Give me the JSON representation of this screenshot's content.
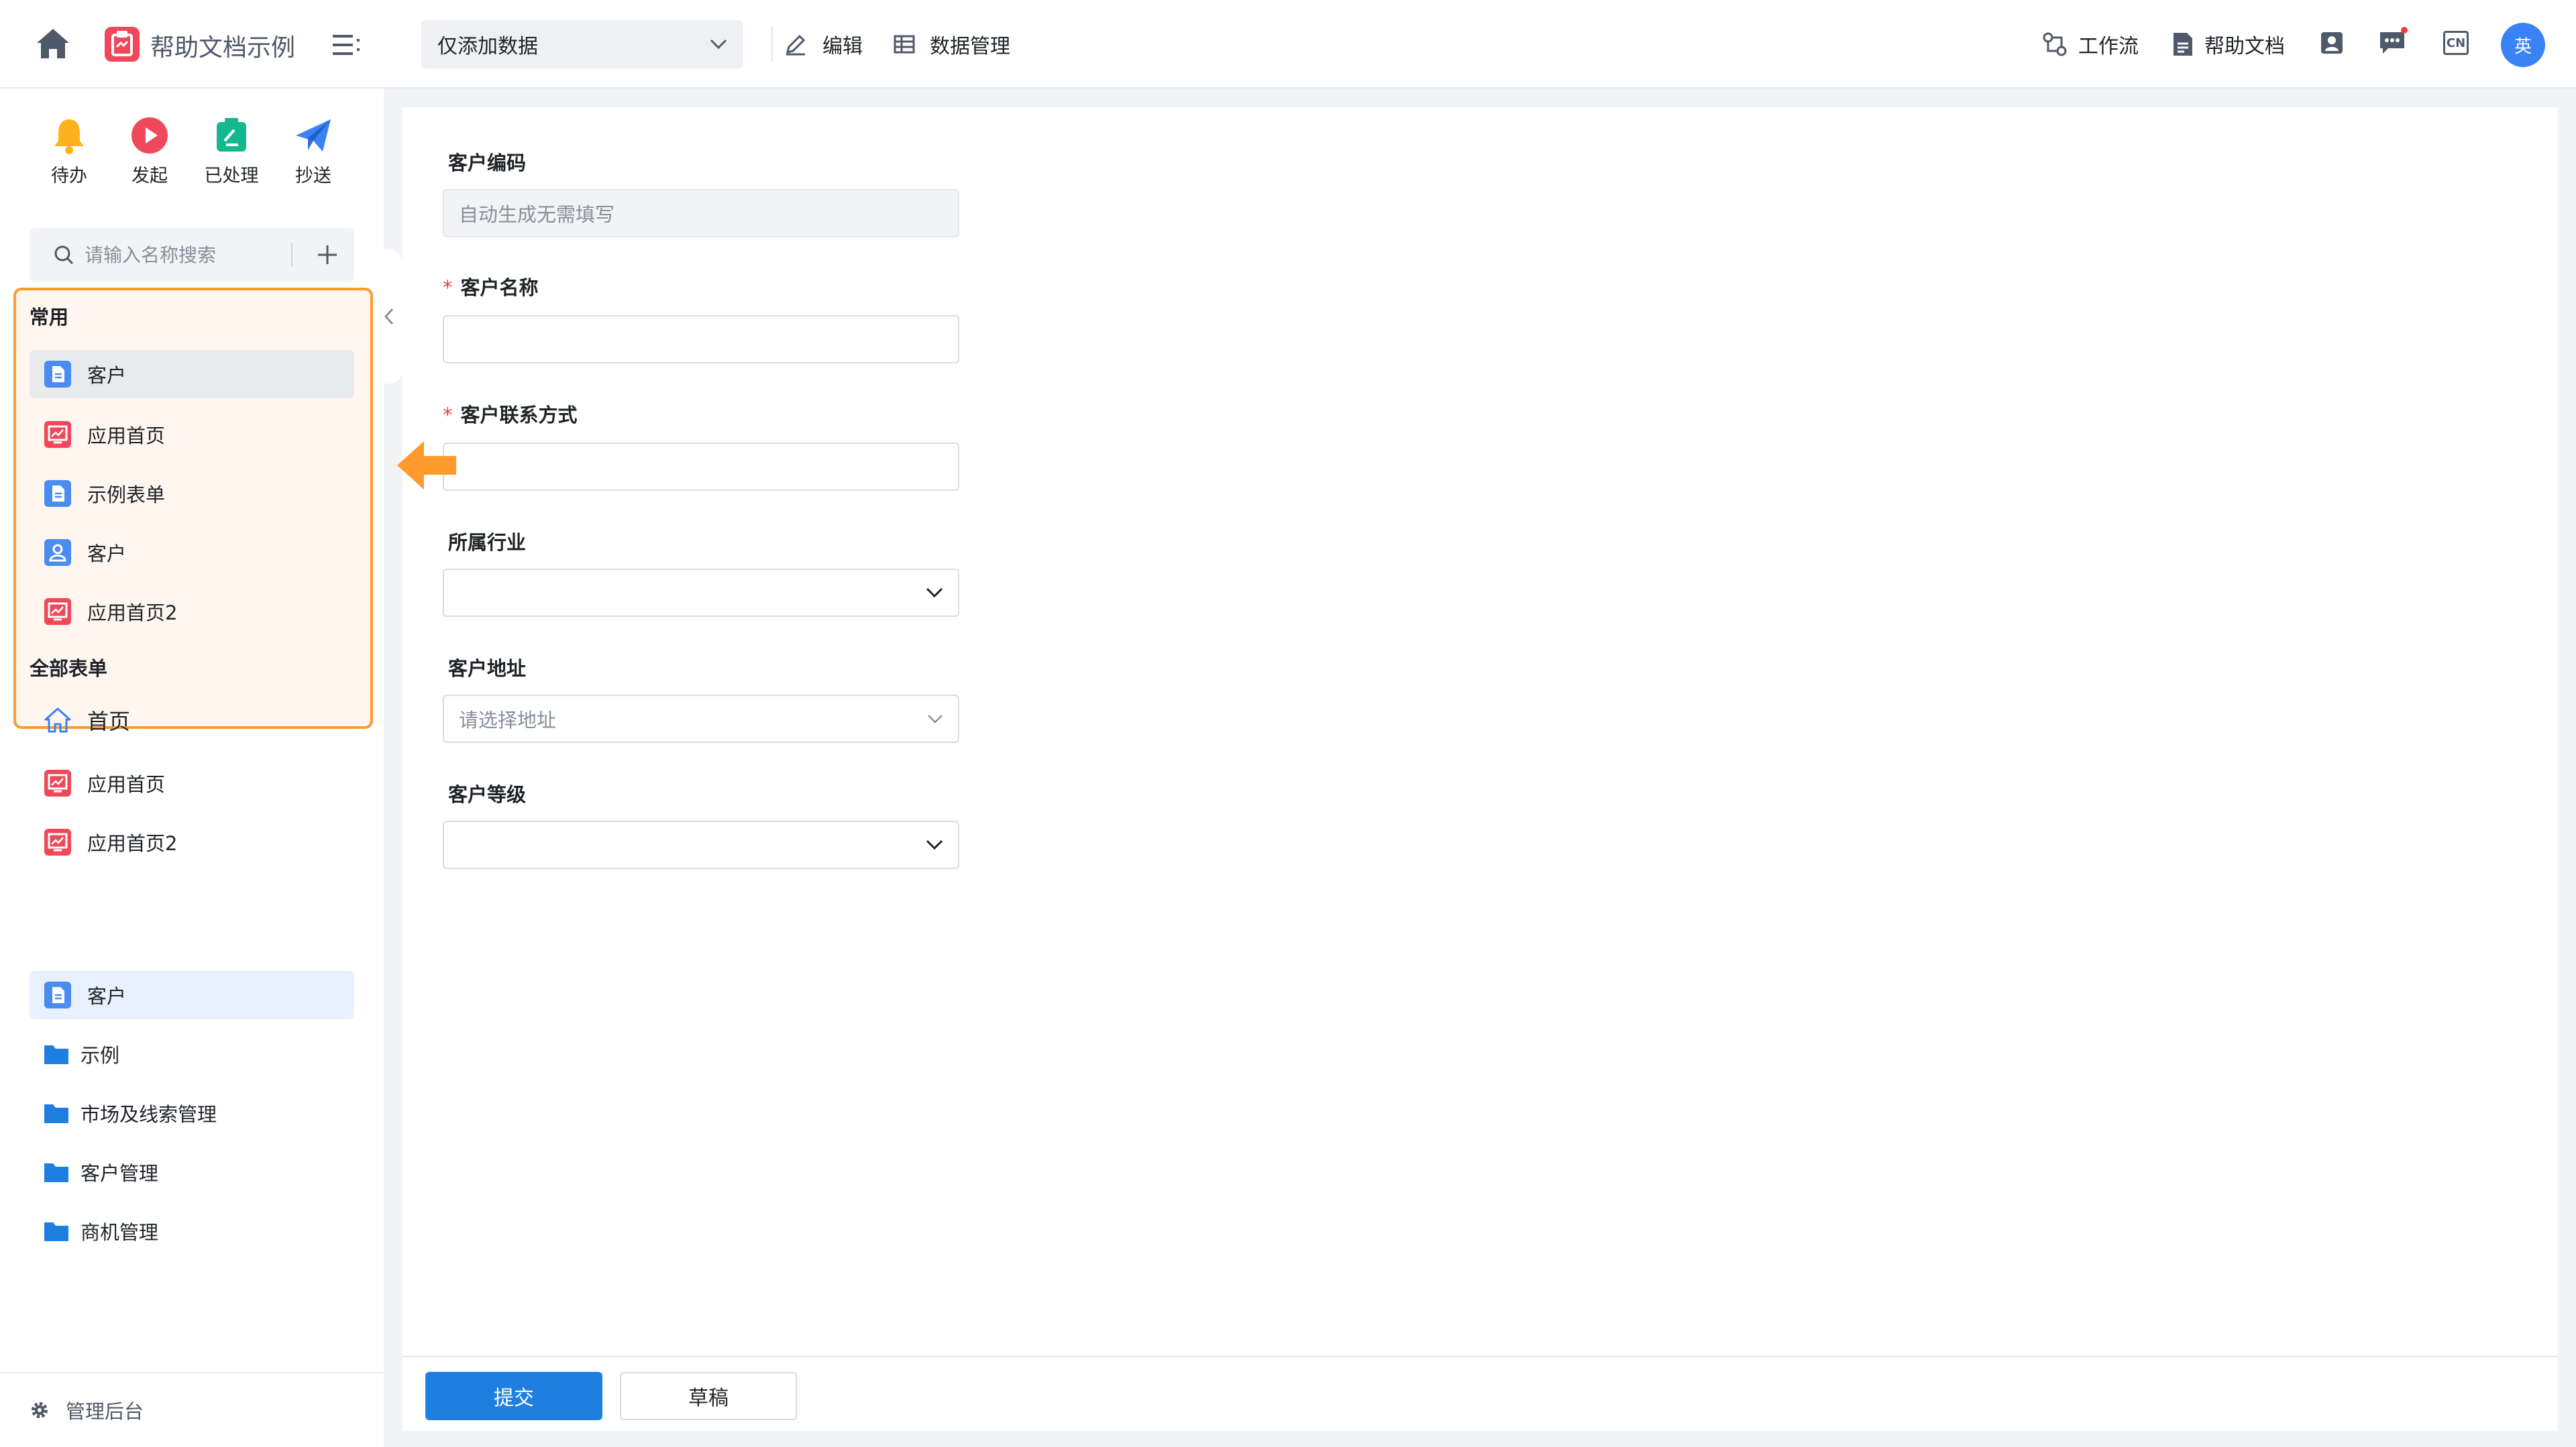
{
  "topbar": {
    "app_title": "帮助文档示例",
    "form_select_value": "仅添加数据",
    "edit_label": "编辑",
    "data_mgmt_label": "数据管理",
    "workflow_label": "工作流",
    "help_doc_label": "帮助文档",
    "lang_badge": "CN",
    "avatar_text": "英",
    "accent_color": "#3b82f6"
  },
  "sidebar": {
    "quick_actions": [
      {
        "label": "待办",
        "icon": "bell-icon"
      },
      {
        "label": "发起",
        "icon": "play-icon"
      },
      {
        "label": "已处理",
        "icon": "done-icon"
      },
      {
        "label": "抄送",
        "icon": "send-icon"
      }
    ],
    "search_placeholder": "请输入名称搜索",
    "favorites_title": "常用",
    "favorites": [
      {
        "label": "客户",
        "icon": "form-doc-icon",
        "selected": true
      },
      {
        "label": "应用首页",
        "icon": "dashboard-icon"
      },
      {
        "label": "示例表单",
        "icon": "form-doc-icon"
      },
      {
        "label": "客户",
        "icon": "user-form-icon"
      },
      {
        "label": "应用首页2",
        "icon": "dashboard-icon"
      }
    ],
    "all_forms_title": "全部表单",
    "all_forms": [
      {
        "label": "首页",
        "icon": "home-outline-icon"
      },
      {
        "label": "应用首页",
        "icon": "dashboard-icon"
      },
      {
        "label": "应用首页2",
        "icon": "dashboard-icon"
      },
      {
        "label": "客户",
        "icon": "form-doc-icon",
        "selected": true
      },
      {
        "label": "示例",
        "icon": "folder-icon"
      },
      {
        "label": "市场及线索管理",
        "icon": "folder-icon"
      },
      {
        "label": "客户管理",
        "icon": "folder-icon"
      },
      {
        "label": "商机管理",
        "icon": "folder-icon"
      }
    ],
    "admin_label": "管理后台",
    "highlight_color": "#ff9a2e"
  },
  "form": {
    "fields": [
      {
        "label": "客户编码",
        "required": false,
        "type": "text",
        "value": "自动生成无需填写",
        "disabled": true
      },
      {
        "label": "客户名称",
        "required": true,
        "type": "text",
        "value": ""
      },
      {
        "label": "客户联系方式",
        "required": true,
        "type": "text",
        "value": ""
      },
      {
        "label": "所属行业",
        "required": false,
        "type": "select",
        "value": ""
      },
      {
        "label": "客户地址",
        "required": false,
        "type": "address",
        "placeholder": "请选择地址"
      },
      {
        "label": "客户等级",
        "required": false,
        "type": "select",
        "value": ""
      }
    ],
    "submit_label": "提交",
    "draft_label": "草稿",
    "primary_color": "#1e7fe0"
  }
}
